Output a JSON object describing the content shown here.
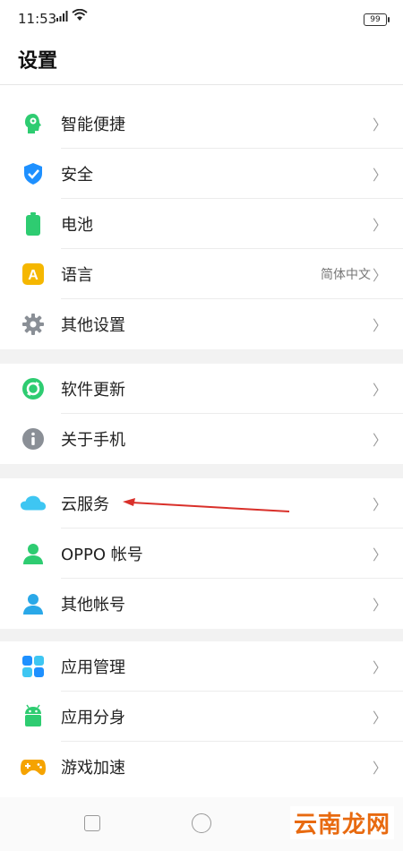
{
  "status_bar": {
    "time": "11:53",
    "signal": "…ıl",
    "battery": "99"
  },
  "page_title": "设置",
  "groups": [
    {
      "items": [
        {
          "name": "smart-shortcuts",
          "label": "智能便捷",
          "icon": "head-gear-icon",
          "value": ""
        },
        {
          "name": "security",
          "label": "安全",
          "icon": "shield-icon",
          "value": ""
        },
        {
          "name": "battery",
          "label": "电池",
          "icon": "battery-icon",
          "value": ""
        },
        {
          "name": "language",
          "label": "语言",
          "icon": "language-a-icon",
          "value": "简体中文"
        },
        {
          "name": "other-settings",
          "label": "其他设置",
          "icon": "gear-icon",
          "value": ""
        }
      ]
    },
    {
      "items": [
        {
          "name": "software-update",
          "label": "软件更新",
          "icon": "update-icon",
          "value": ""
        },
        {
          "name": "about-phone",
          "label": "关于手机",
          "icon": "info-icon",
          "value": ""
        }
      ]
    },
    {
      "items": [
        {
          "name": "cloud-service",
          "label": "云服务",
          "icon": "cloud-icon",
          "value": ""
        },
        {
          "name": "oppo-account",
          "label": "OPPO 帐号",
          "icon": "user-green-icon",
          "value": ""
        },
        {
          "name": "other-accounts",
          "label": "其他帐号",
          "icon": "user-blue-icon",
          "value": ""
        }
      ]
    },
    {
      "items": [
        {
          "name": "app-management",
          "label": "应用管理",
          "icon": "grid-icon",
          "value": ""
        },
        {
          "name": "app-clone",
          "label": "应用分身",
          "icon": "android-icon",
          "value": ""
        },
        {
          "name": "game-acceleration",
          "label": "游戏加速",
          "icon": "gamepad-icon",
          "value": ""
        }
      ]
    }
  ],
  "chevron": "〉",
  "watermark": "云南龙网",
  "colors": {
    "accent_green": "#2ecc71",
    "shield_blue": "#1e90ff",
    "battery_green": "#2ecc71",
    "language_yellow": "#f5b700",
    "gear_gray": "#8a8f96",
    "cloud_blue": "#3ec6f2",
    "annotation_red": "#d9302a"
  }
}
